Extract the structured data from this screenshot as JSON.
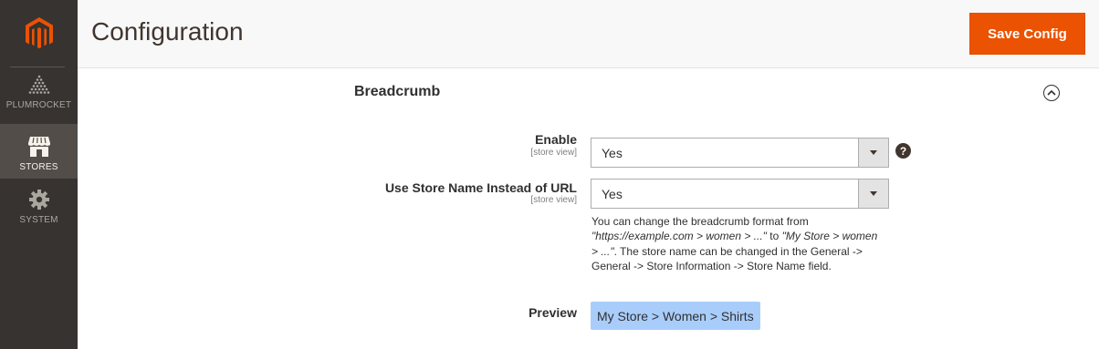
{
  "sidebar": {
    "items": [
      {
        "label": "PLUMROCKET",
        "icon": "plumrocket-icon"
      },
      {
        "label": "STORES",
        "icon": "store-icon",
        "active": true
      },
      {
        "label": "SYSTEM",
        "icon": "gear-icon"
      }
    ]
  },
  "header": {
    "title": "Configuration",
    "save_label": "Save Config"
  },
  "section": {
    "title": "Breadcrumb",
    "fields": [
      {
        "label": "Enable",
        "scope": "[store view]",
        "value": "Yes"
      },
      {
        "label": "Use Store Name Instead of URL",
        "scope": "[store view]",
        "value": "Yes"
      }
    ],
    "note": {
      "part1": "You can change the breadcrumb format from ",
      "example1": "\"https://example.com > women > ...\"",
      "part2": " to ",
      "example2": "\"My Store > women > ...\"",
      "part3": ". The store name can be changed in the General -> General -> Store Information -> Store Name field."
    },
    "preview": {
      "label": "Preview",
      "value": "My Store > Women > Shirts"
    },
    "help_glyph": "?"
  },
  "colors": {
    "sidebar_bg": "#373330",
    "accent": "#eb5202",
    "preview_bg": "#a9cdfb"
  }
}
